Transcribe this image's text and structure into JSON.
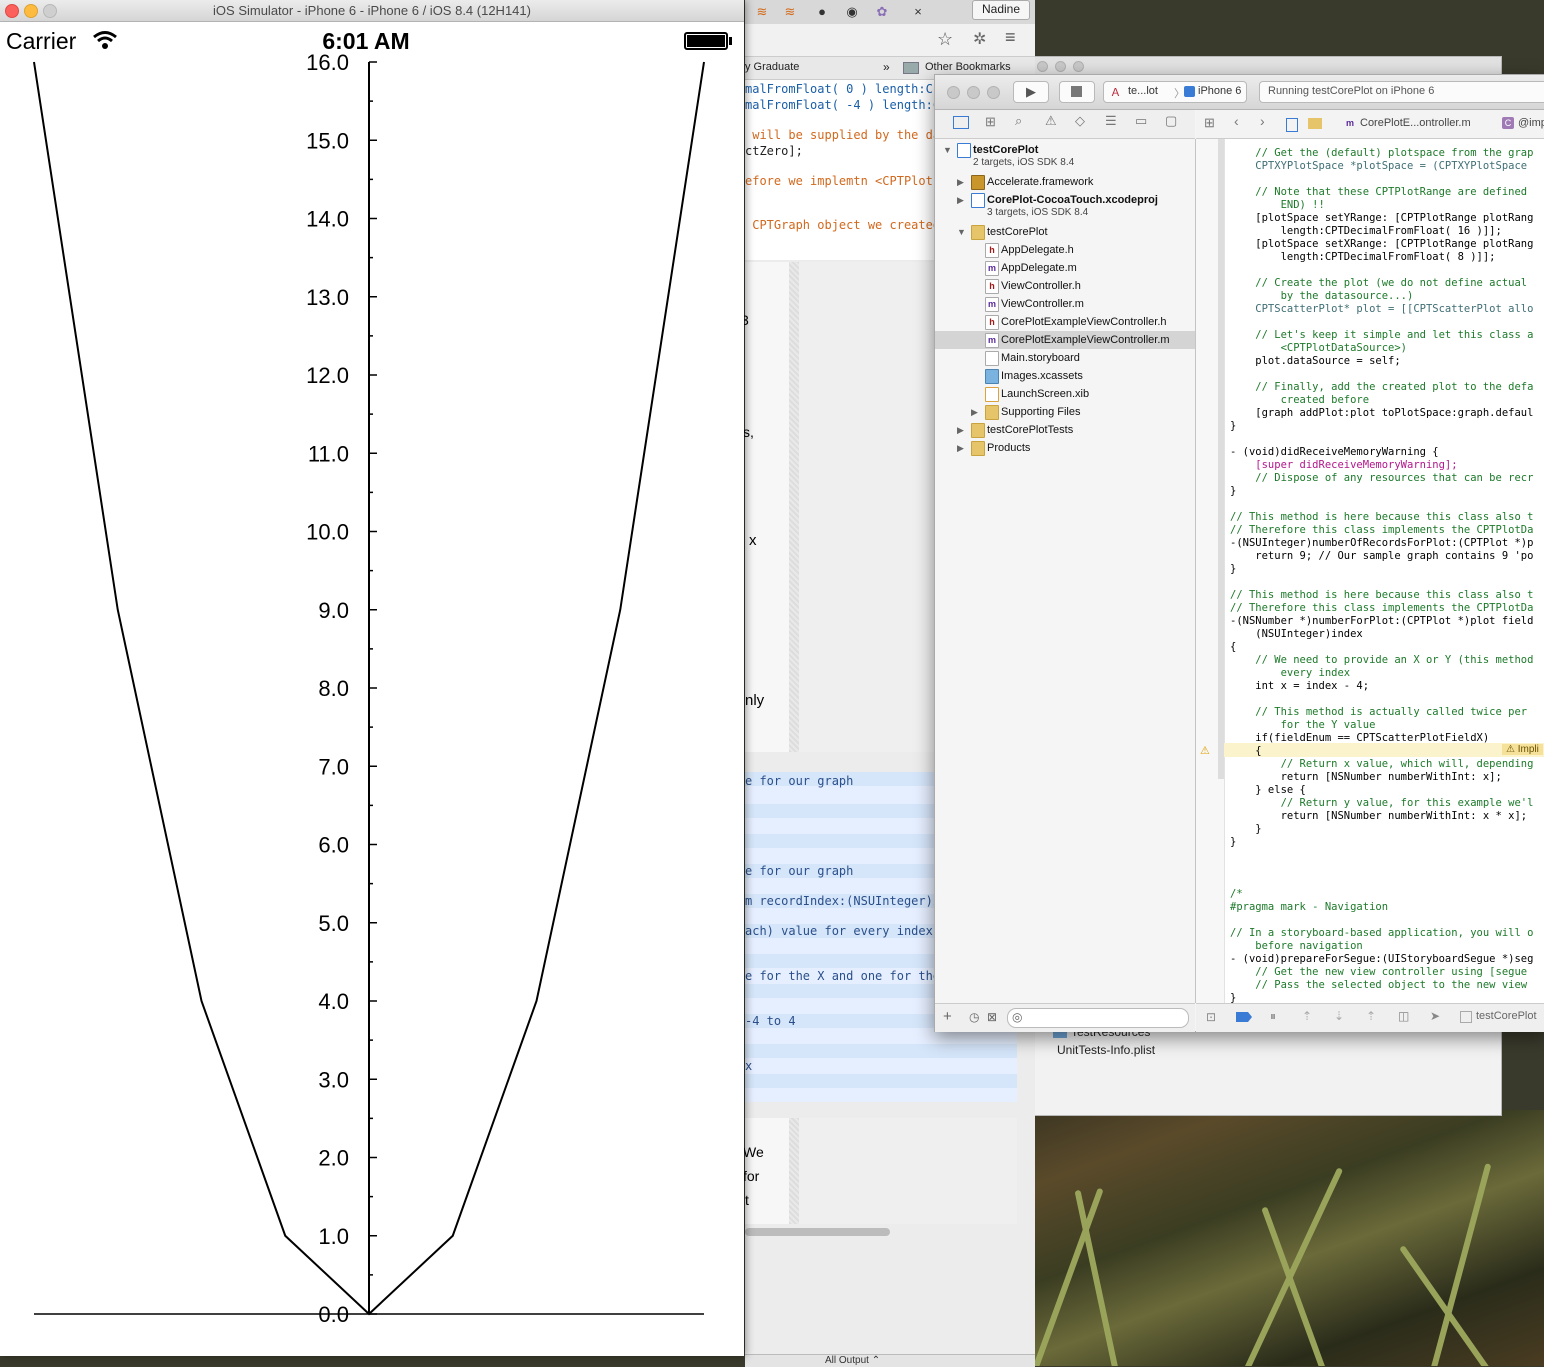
{
  "simulator": {
    "title": "iOS Simulator - iPhone 6 - iPhone 6 / iOS 8.4 (12H141)",
    "status": {
      "carrier": "Carrier",
      "time": "6:01 AM"
    }
  },
  "chart_data": {
    "type": "line",
    "x": [
      -4,
      -3,
      -2,
      -1,
      0,
      1,
      2,
      3,
      4
    ],
    "y": [
      16,
      9,
      4,
      1,
      0,
      1,
      4,
      9,
      16
    ],
    "xlim": [
      -4,
      4
    ],
    "ylim": [
      0,
      16
    ],
    "yticks": [
      "0.0",
      "1.0",
      "2.0",
      "3.0",
      "4.0",
      "5.0",
      "6.0",
      "7.0",
      "8.0",
      "9.0",
      "10.0",
      "11.0",
      "12.0",
      "13.0",
      "14.0",
      "15.0",
      "16.0"
    ],
    "grid": false,
    "line_color": "#000000"
  },
  "browser": {
    "profile": "Nadine",
    "bookmarks": {
      "left": "y Graduate",
      "chevron": "»",
      "other": "Other Bookmarks"
    },
    "close": "×",
    "code_lines": [
      "malFromFloat( 0 ) length:CP",
      "malFromFloat( -4 ) length:C",
      " will be supplied by the da",
      "ctZero];",
      "efore we implemtn <CPTPlot",
      " CPTGraph object we created"
    ],
    "fragments": [
      "3",
      "s,",
      "x",
      "nly",
      "We",
      "for",
      "t"
    ],
    "blue_lines": [
      "e for our graph",
      "e for our graph",
      "m recordIndex:(NSUInteger)i",
      "ach) value for every index",
      "e for the X and one for the",
      "-4 to 4",
      "x"
    ],
    "bottom": {
      "filter": "All Output ⌃"
    }
  },
  "xcode": {
    "scheme": "te...lot",
    "device": "iPhone 6",
    "activity": "Running testCorePlot on iPhone 6",
    "jump": {
      "file": "CorePlotE...ontroller.m",
      "symbol": "@imp"
    },
    "navigator": [
      {
        "name": "testCorePlot",
        "sub": "2 targets, iOS SDK 8.4",
        "indent": 0,
        "disc": "▼",
        "icon": "proj",
        "bold": true
      },
      {
        "name": "Accelerate.framework",
        "indent": 1,
        "disc": "▶",
        "icon": "toolbox"
      },
      {
        "name": "CorePlot-CocoaTouch.xcodeproj",
        "sub": "3 targets, iOS SDK 8.4",
        "indent": 1,
        "disc": "▶",
        "icon": "proj",
        "bold": true
      },
      {
        "name": "testCorePlot",
        "indent": 1,
        "disc": "▼",
        "icon": "folder"
      },
      {
        "name": "AppDelegate.h",
        "indent": 2,
        "icon": "h"
      },
      {
        "name": "AppDelegate.m",
        "indent": 2,
        "icon": "m"
      },
      {
        "name": "ViewController.h",
        "indent": 2,
        "icon": "h"
      },
      {
        "name": "ViewController.m",
        "indent": 2,
        "icon": "m"
      },
      {
        "name": "CorePlotExampleViewController.h",
        "indent": 2,
        "icon": "h"
      },
      {
        "name": "CorePlotExampleViewController.m",
        "indent": 2,
        "icon": "m",
        "selected": true
      },
      {
        "name": "Main.storyboard",
        "indent": 2,
        "icon": "sb"
      },
      {
        "name": "Images.xcassets",
        "indent": 2,
        "icon": "assets"
      },
      {
        "name": "LaunchScreen.xib",
        "indent": 2,
        "icon": "xib"
      },
      {
        "name": "Supporting Files",
        "indent": 2,
        "disc": "▶",
        "icon": "folder"
      },
      {
        "name": "testCorePlotTests",
        "indent": 1,
        "disc": "▶",
        "icon": "folder"
      },
      {
        "name": "Products",
        "indent": 1,
        "disc": "▶",
        "icon": "folder"
      }
    ],
    "code": [
      [
        "cm",
        "    // Get the (default) plotspace from the grap"
      ],
      [
        "ty",
        "    CPTXYPlotSpace *plotSpace = (CPTXYPlotSpace"
      ],
      [
        "",
        ""
      ],
      [
        "cm",
        "    // Note that these CPTPlotRange are defined"
      ],
      [
        "cm",
        "        END) !!"
      ],
      [
        "",
        "    [plotSpace setYRange: [CPTPlotRange plotRang"
      ],
      [
        "",
        "        length:CPTDecimalFromFloat( 16 )]];"
      ],
      [
        "",
        "    [plotSpace setXRange: [CPTPlotRange plotRang"
      ],
      [
        "",
        "        length:CPTDecimalFromFloat( 8 )]];"
      ],
      [
        "",
        ""
      ],
      [
        "cm",
        "    // Create the plot (we do not define actual"
      ],
      [
        "cm",
        "        by the datasource...)"
      ],
      [
        "ty",
        "    CPTScatterPlot* plot = [[CPTScatterPlot allo"
      ],
      [
        "",
        ""
      ],
      [
        "cm",
        "    // Let's keep it simple and let this class a"
      ],
      [
        "cm",
        "        <CPTPlotDataSource>)"
      ],
      [
        "",
        "    plot.dataSource = self;"
      ],
      [
        "",
        ""
      ],
      [
        "cm",
        "    // Finally, add the created plot to the defa"
      ],
      [
        "cm",
        "        created before"
      ],
      [
        "",
        "    [graph addPlot:plot toPlotSpace:graph.defaul"
      ],
      [
        "",
        "}"
      ],
      [
        "",
        ""
      ],
      [
        "",
        "- (void)didReceiveMemoryWarning {"
      ],
      [
        "kw",
        "    [super didReceiveMemoryWarning];"
      ],
      [
        "cm",
        "    // Dispose of any resources that can be recr"
      ],
      [
        "",
        "}"
      ],
      [
        "",
        ""
      ],
      [
        "cm",
        "// This method is here because this class also t"
      ],
      [
        "cm",
        "// Therefore this class implements the CPTPlotDa"
      ],
      [
        "",
        "-(NSUInteger)numberOfRecordsForPlot:(CPTPlot *)p"
      ],
      [
        "",
        "    return 9; // Our sample graph contains 9 'po"
      ],
      [
        "",
        "}"
      ],
      [
        "",
        ""
      ],
      [
        "cm",
        "// This method is here because this class also t"
      ],
      [
        "cm",
        "// Therefore this class implements the CPTPlotDa"
      ],
      [
        "",
        "-(NSNumber *)numberForPlot:(CPTPlot *)plot field"
      ],
      [
        "",
        "    (NSUInteger)index"
      ],
      [
        "",
        "{"
      ],
      [
        "cm",
        "    // We need to provide an X or Y (this method"
      ],
      [
        "cm",
        "        every index"
      ],
      [
        "",
        "    int x = index - 4;"
      ],
      [
        "",
        ""
      ],
      [
        "cm",
        "    // This method is actually called twice per"
      ],
      [
        "cm",
        "        for the Y value"
      ],
      [
        "",
        "    if(fieldEnum == CPTScatterPlotFieldX)"
      ],
      [
        "",
        "    {"
      ],
      [
        "cm",
        "        // Return x value, which will, depending"
      ],
      [
        "",
        "        return [NSNumber numberWithInt: x];"
      ],
      [
        "",
        "    } else {"
      ],
      [
        "cm",
        "        // Return y value, for this example we'l"
      ],
      [
        "",
        "        return [NSNumber numberWithInt: x * x];"
      ],
      [
        "",
        "    }"
      ],
      [
        "",
        "}"
      ],
      [
        "",
        ""
      ],
      [
        "",
        ""
      ],
      [
        "",
        ""
      ],
      [
        "cm",
        "/*"
      ],
      [
        "cm",
        "#pragma mark - Navigation"
      ],
      [
        "",
        ""
      ],
      [
        "cm",
        "// In a storyboard-based application, you will o"
      ],
      [
        "cm",
        "    before navigation"
      ],
      [
        "",
        "- (void)prepareForSegue:(UIStoryboardSegue *)seg"
      ],
      [
        "cm",
        "    // Get the new view controller using [segue"
      ],
      [
        "cm",
        "    // Pass the selected object to the new view"
      ],
      [
        "",
        "}"
      ]
    ],
    "warning_badge": "Impli",
    "debug_target": "testCorePlot"
  },
  "third_window": {
    "items": [
      "TestResources",
      "UnitTests-Info.plist"
    ]
  }
}
